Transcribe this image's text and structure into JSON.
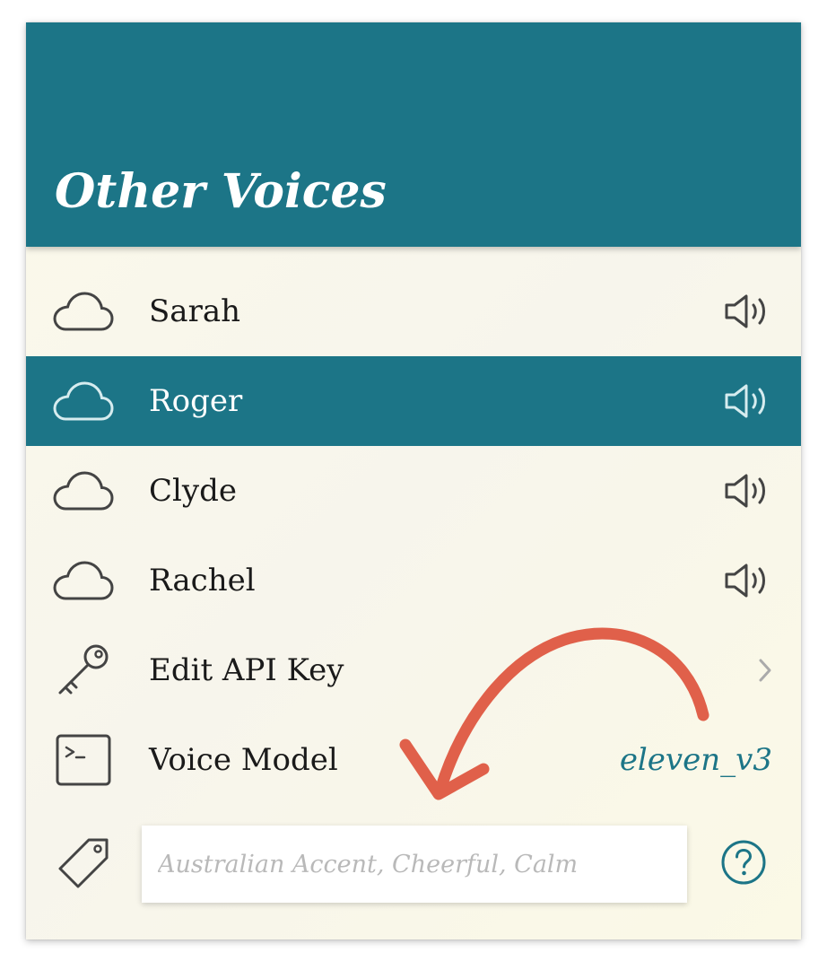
{
  "header": {
    "title": "Other Voices"
  },
  "voices": [
    {
      "label": "Sarah",
      "icon": "cloud-icon",
      "action_icon": "speaker-icon",
      "selected": false
    },
    {
      "label": "Roger",
      "icon": "cloud-icon",
      "action_icon": "speaker-icon",
      "selected": true
    },
    {
      "label": "Clyde",
      "icon": "cloud-icon",
      "action_icon": "speaker-icon",
      "selected": false
    },
    {
      "label": "Rachel",
      "icon": "cloud-icon",
      "action_icon": "speaker-icon",
      "selected": false
    }
  ],
  "api_key": {
    "label": "Edit API Key",
    "icon": "key-icon",
    "trail_icon": "chevron-right-icon"
  },
  "voice_model": {
    "label": "Voice Model",
    "icon": "terminal-icon",
    "value": "eleven_v3"
  },
  "tags": {
    "icon": "tag-icon",
    "value": "",
    "placeholder": "Australian Accent, Cheerful, Calm",
    "help_icon": "help-icon"
  },
  "colors": {
    "accent": "#1c7587",
    "background": "#fbf9ea",
    "annotation_arrow": "#e0604a"
  }
}
